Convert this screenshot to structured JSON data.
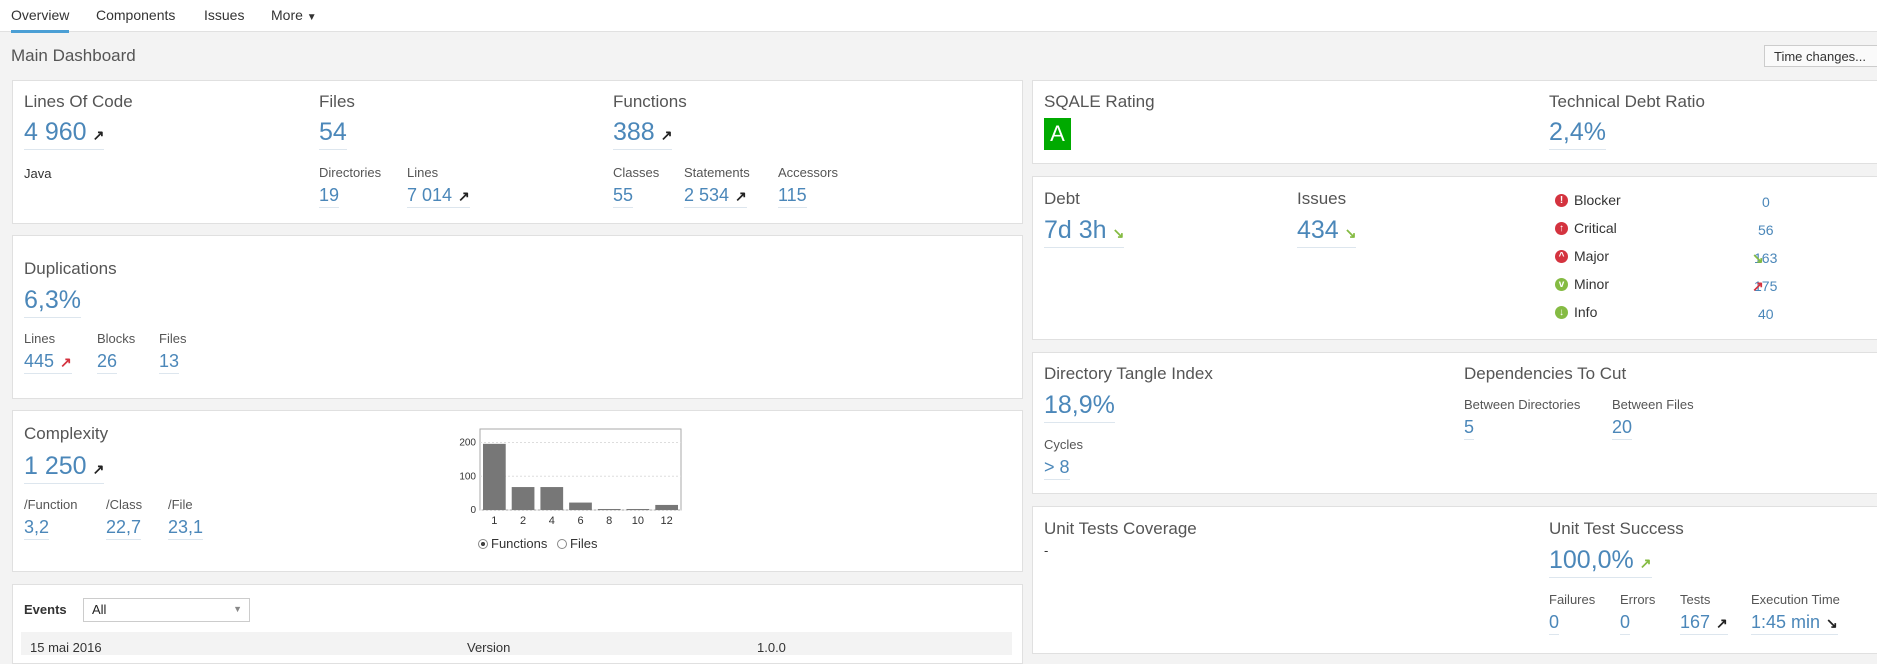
{
  "tabs": [
    "Overview",
    "Components",
    "Issues",
    "More"
  ],
  "page_title": "Main Dashboard",
  "time_changes": "Time changes...",
  "size": {
    "loc_label": "Lines Of Code",
    "loc_value": "4 960",
    "language": "Java",
    "files_label": "Files",
    "files_value": "54",
    "directories_label": "Directories",
    "directories_value": "19",
    "lines_label": "Lines",
    "lines_value": "7 014",
    "functions_label": "Functions",
    "functions_value": "388",
    "classes_label": "Classes",
    "classes_value": "55",
    "statements_label": "Statements",
    "statements_value": "2 534",
    "accessors_label": "Accessors",
    "accessors_value": "115"
  },
  "duplications": {
    "label": "Duplications",
    "value": "6,3%",
    "lines_label": "Lines",
    "lines_value": "445",
    "blocks_label": "Blocks",
    "blocks_value": "26",
    "files_label": "Files",
    "files_value": "13"
  },
  "complexity": {
    "label": "Complexity",
    "value": "1 250",
    "per_function_label": "/Function",
    "per_function_value": "3,2",
    "per_class_label": "/Class",
    "per_class_value": "22,7",
    "per_file_label": "/File",
    "per_file_value": "23,1",
    "radio_functions": "Functions",
    "radio_files": "Files"
  },
  "chart_data": {
    "type": "bar",
    "categories": [
      "1",
      "2",
      "4",
      "6",
      "8",
      "10",
      "12"
    ],
    "values": [
      196,
      68,
      68,
      22,
      3,
      3,
      15
    ],
    "yticks": [
      "0",
      "100",
      "200"
    ],
    "ylim": [
      0,
      240
    ]
  },
  "events": {
    "label": "Events",
    "filter": "All",
    "row_date": "15 mai 2016",
    "row_type": "Version",
    "row_value": "1.0.0"
  },
  "sqale": {
    "label": "SQALE Rating",
    "grade": "A",
    "grade_color": "#00aa00"
  },
  "debt_ratio": {
    "label": "Technical Debt Ratio",
    "value": "2,4%"
  },
  "debt": {
    "label": "Debt",
    "value": "7d 3h"
  },
  "issues": {
    "label": "Issues",
    "value": "434",
    "severities": [
      {
        "name": "Blocker",
        "count": "0",
        "color": "#d4333f",
        "glyph": "!"
      },
      {
        "name": "Critical",
        "count": "56",
        "color": "#d4333f",
        "glyph": "↑"
      },
      {
        "name": "Major",
        "count": "163",
        "color": "#d4333f",
        "glyph": "^"
      },
      {
        "name": "Minor",
        "count": "175",
        "color": "#85bb43",
        "glyph": "v"
      },
      {
        "name": "Info",
        "count": "40",
        "color": "#85bb43",
        "glyph": "↓"
      }
    ]
  },
  "tangle": {
    "label": "Directory Tangle Index",
    "value": "18,9%",
    "cycles_label": "Cycles",
    "cycles_value": "> 8"
  },
  "dependencies": {
    "label": "Dependencies To Cut",
    "between_dirs_label": "Between Directories",
    "between_dirs_value": "5",
    "between_files_label": "Between Files",
    "between_files_value": "20"
  },
  "coverage": {
    "label": "Unit Tests Coverage",
    "value": "-"
  },
  "test_success": {
    "label": "Unit Test Success",
    "value": "100,0%",
    "failures_label": "Failures",
    "failures_value": "0",
    "errors_label": "Errors",
    "errors_value": "0",
    "tests_label": "Tests",
    "tests_value": "167",
    "exec_label": "Execution Time",
    "exec_value": "1:45 min"
  }
}
